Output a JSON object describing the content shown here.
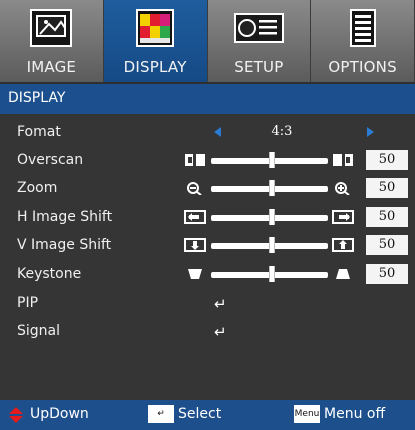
{
  "tabs": [
    {
      "label": "IMAGE",
      "icon": "image-icon"
    },
    {
      "label": "DISPLAY",
      "icon": "display-icon",
      "active": true
    },
    {
      "label": "SETUP",
      "icon": "projector-icon"
    },
    {
      "label": "OPTIONS",
      "icon": "options-icon"
    }
  ],
  "title": "DISPLAY",
  "menu": {
    "fomat": {
      "label": "Fomat",
      "value": "4:3"
    },
    "overscan": {
      "label": "Overscan",
      "value": "50"
    },
    "zoom": {
      "label": "Zoom",
      "value": "50"
    },
    "h_shift": {
      "label": "H Image Shift",
      "value": "50"
    },
    "v_shift": {
      "label": "V Image Shift",
      "value": "50"
    },
    "keystone": {
      "label": "Keystone",
      "value": "50"
    },
    "pip": {
      "label": "PIP"
    },
    "signal": {
      "label": "Signal"
    }
  },
  "footer": {
    "updown": "UpDown",
    "select": "Select",
    "menu_key": "Menu",
    "menu_off": "Menu off"
  }
}
